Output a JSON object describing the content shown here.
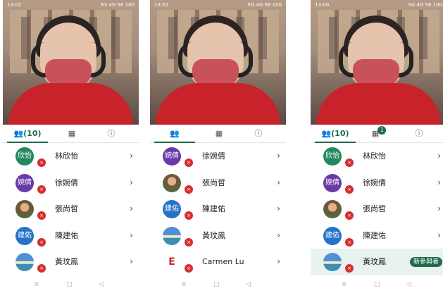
{
  "phones": [
    {
      "status_time": "13:02",
      "status_right": "5G 4G 56 100",
      "tabs": [
        "(10)",
        "",
        ""
      ],
      "tab_badge": "",
      "rows": [
        {
          "avatar_text": "欣怡",
          "avatar_style": "av-green",
          "name": "林欣怡",
          "tag": ""
        },
        {
          "avatar_text": "婉倩",
          "avatar_style": "av-purple",
          "name": "徐婉倩",
          "tag": ""
        },
        {
          "avatar_text": "",
          "avatar_style": "av-photo",
          "name": "張尚哲",
          "tag": ""
        },
        {
          "avatar_text": "建佑",
          "avatar_style": "av-blue",
          "name": "陳建佑",
          "tag": ""
        },
        {
          "avatar_text": "",
          "avatar_style": "av-sky",
          "name": "黃玟鳳",
          "tag": ""
        }
      ]
    },
    {
      "status_time": "13:02",
      "status_right": "5G 4G 56 100",
      "tabs": [
        "",
        "",
        ""
      ],
      "tab_badge": "",
      "rows": [
        {
          "avatar_text": "婉倩",
          "avatar_style": "av-purple",
          "name": "徐婉倩",
          "tag": ""
        },
        {
          "avatar_text": "",
          "avatar_style": "av-photo",
          "name": "張尚哲",
          "tag": ""
        },
        {
          "avatar_text": "建佑",
          "avatar_style": "av-blue",
          "name": "陳建佑",
          "tag": ""
        },
        {
          "avatar_text": "",
          "avatar_style": "av-sky",
          "name": "黃玟鳳",
          "tag": ""
        },
        {
          "avatar_text": "E",
          "avatar_style": "av-text",
          "name": "Carmen Lu",
          "tag": ""
        }
      ]
    },
    {
      "status_time": "13:00",
      "status_right": "5G 4G 56 100",
      "tabs": [
        "(10)",
        "",
        ""
      ],
      "tab_badge": "1",
      "rows": [
        {
          "avatar_text": "欣怡",
          "avatar_style": "av-green",
          "name": "林欣怡",
          "tag": ""
        },
        {
          "avatar_text": "婉倩",
          "avatar_style": "av-purple",
          "name": "徐婉倩",
          "tag": ""
        },
        {
          "avatar_text": "",
          "avatar_style": "av-photo",
          "name": "張尚哲",
          "tag": ""
        },
        {
          "avatar_text": "建佑",
          "avatar_style": "av-blue",
          "name": "陳建佑",
          "tag": ""
        },
        {
          "avatar_text": "",
          "avatar_style": "av-sky",
          "name": "黃玟鳳",
          "tag": "新參與者"
        }
      ]
    }
  ],
  "icons": {
    "participants": "people-icon",
    "chat": "chat-icon",
    "info": "info-icon",
    "mic_muted": "mic-muted-icon",
    "chevron": "chevron-right-icon"
  },
  "colors": {
    "accent": "#1f6b4b",
    "muted": "#d4302e"
  }
}
